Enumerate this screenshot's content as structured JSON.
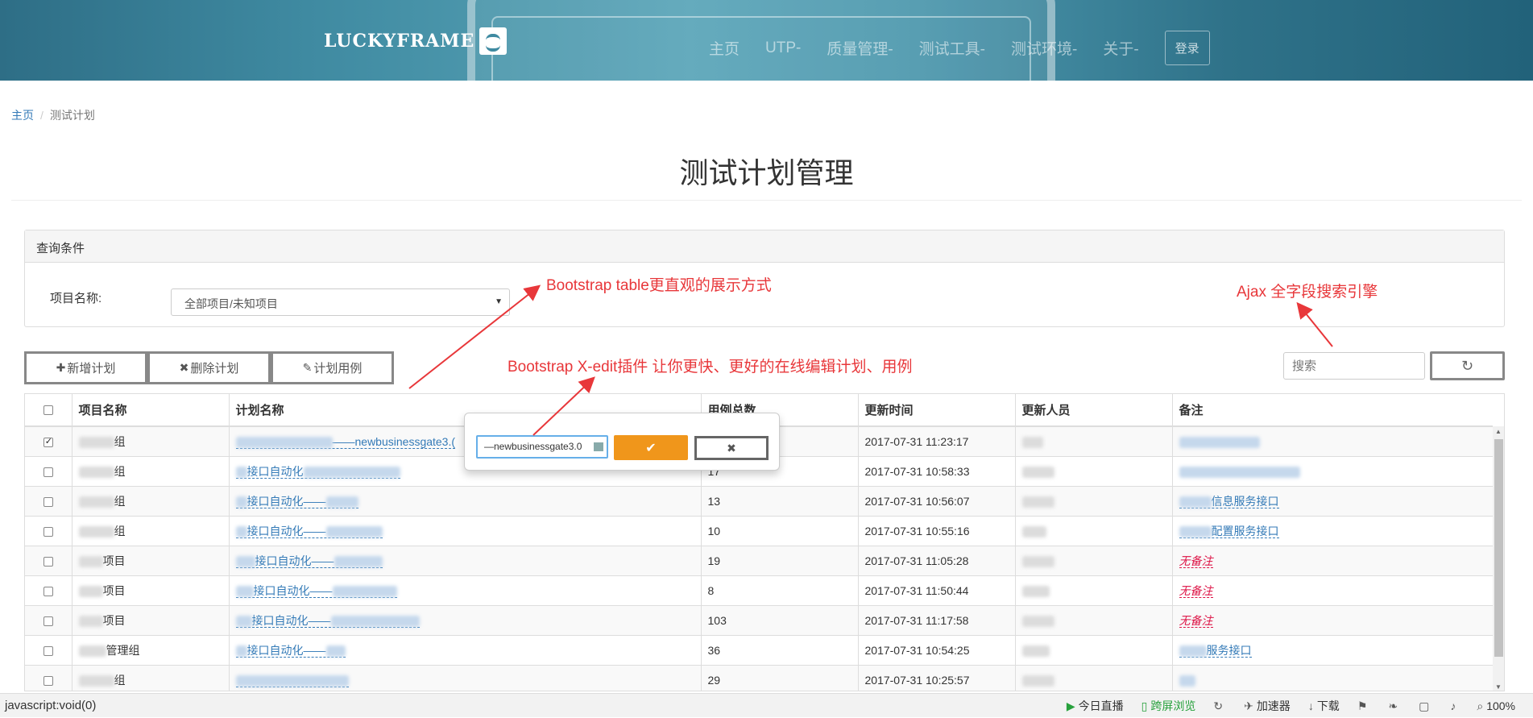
{
  "header": {
    "logo": "LUCKYFRAME",
    "nav": [
      "主页",
      "UTP-",
      "质量管理-",
      "测试工具-",
      "测试环境-",
      "关于-"
    ],
    "login": "登录"
  },
  "breadcrumb": {
    "home": "主页",
    "current": "测试计划"
  },
  "page_title": "测试计划管理",
  "query_panel": {
    "title": "查询条件",
    "project_label": "项目名称:",
    "project_value": "全部项目/未知项目"
  },
  "toolbar": {
    "add": "新增计划",
    "delete": "删除计划",
    "cases": "计划用例",
    "search_placeholder": "搜索"
  },
  "table": {
    "columns": [
      "项目名称",
      "计划名称",
      "用例总数",
      "更新时间",
      "更新人员",
      "备注"
    ],
    "rows": [
      {
        "project": "组",
        "plan": "——newbusinessgate3.(",
        "count": "",
        "time": "2017-07-31 11:23:17",
        "note": "",
        "checked": true
      },
      {
        "project": "组",
        "plan": "接口自动化",
        "count": "17",
        "time": "2017-07-31 10:58:33",
        "note": ""
      },
      {
        "project": "组",
        "plan": "接口自动化——",
        "count": "13",
        "time": "2017-07-31 10:56:07",
        "note": "信息服务接口"
      },
      {
        "project": "组",
        "plan": "接口自动化——",
        "count": "10",
        "time": "2017-07-31 10:55:16",
        "note": "配置服务接口"
      },
      {
        "project": "项目",
        "plan": "接口自动化——",
        "count": "19",
        "time": "2017-07-31 11:05:28",
        "note": "无备注"
      },
      {
        "project": "项目",
        "plan": "接口自动化——",
        "count": "8",
        "time": "2017-07-31 11:50:44",
        "note": "无备注"
      },
      {
        "project": "项目",
        "plan": "接口自动化——",
        "count": "103",
        "time": "2017-07-31 11:17:58",
        "note": "无备注"
      },
      {
        "project": "管理组",
        "plan": "接口自动化——",
        "count": "36",
        "time": "2017-07-31 10:54:25",
        "note": "服务接口"
      },
      {
        "project": "组",
        "plan": "",
        "count": "29",
        "time": "2017-07-31 10:25:57",
        "note": ""
      }
    ]
  },
  "popup": {
    "value": "—newbusinessgate3.0"
  },
  "annotations": {
    "table": "Bootstrap table更直观的展示方式",
    "xedit": "Bootstrap X-edit插件 让你更快、更好的在线编辑计划、用例",
    "ajax": "Ajax 全字段搜索引擎"
  },
  "statusbar": {
    "left": "javascript:void(0)",
    "items": [
      "今日直播",
      "跨屏浏览",
      "加速器",
      "下载",
      "100%"
    ]
  },
  "colors": {
    "accent": "#f0961b",
    "annotation": "#e8373a",
    "link": "#337ab7"
  }
}
